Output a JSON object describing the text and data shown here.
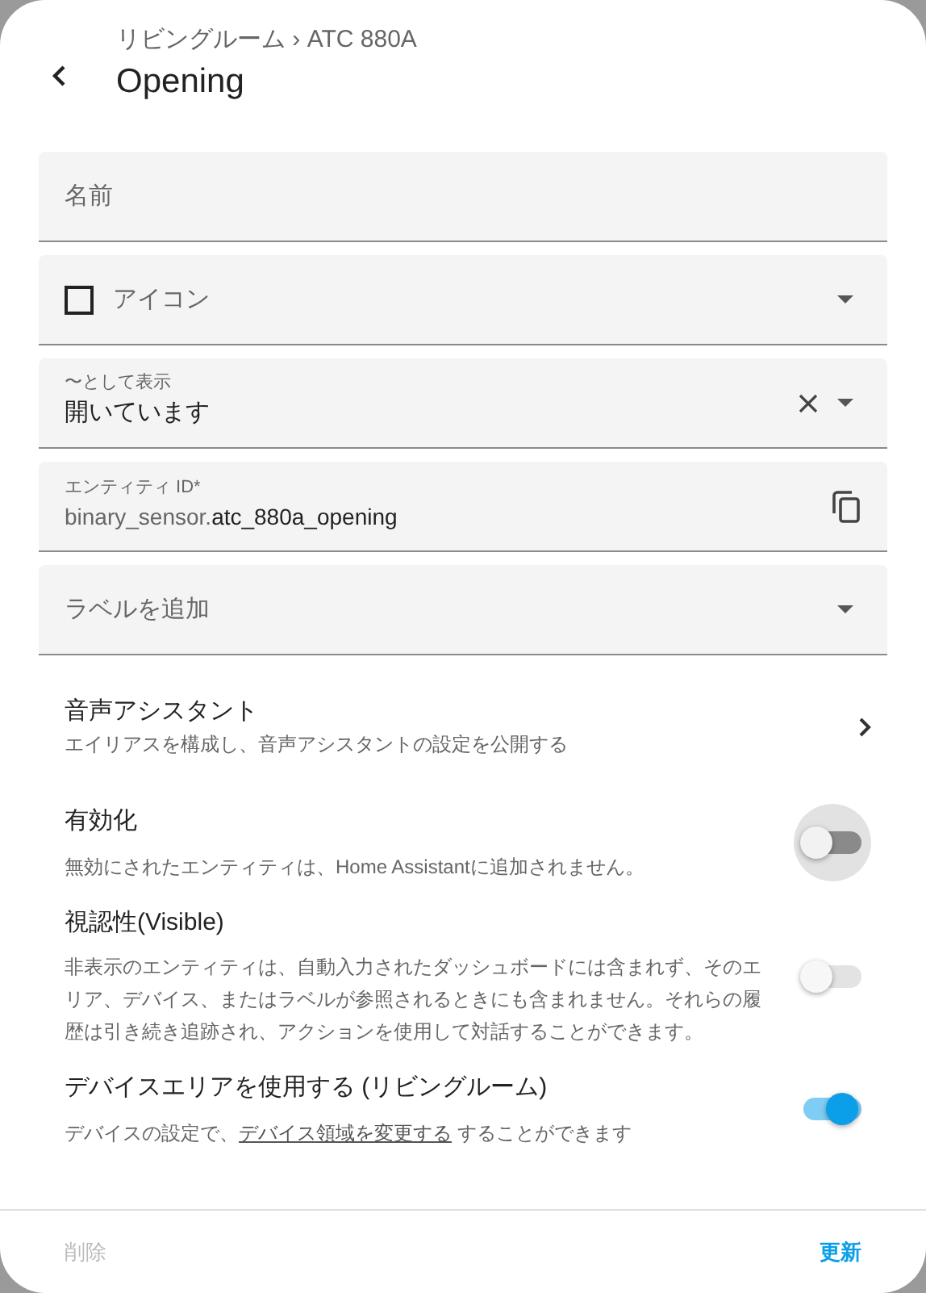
{
  "header": {
    "breadcrumb": "リビングルーム › ATC 880A",
    "title": "Opening"
  },
  "fields": [
    {
      "kind": "text",
      "placeholder": "名前"
    },
    {
      "kind": "icon",
      "placeholder": "アイコン"
    },
    {
      "kind": "select",
      "label": "〜として表示",
      "value": "開いています"
    },
    {
      "kind": "entity",
      "label": "エンティティ ID*",
      "prefix": "binary_sensor.",
      "value": "atc_880a_opening"
    },
    {
      "kind": "labels",
      "placeholder": "ラベルを追加"
    }
  ],
  "voice": {
    "title": "音声アシスタント",
    "description": "エイリアスを構成し、音声アシスタントの設定を公開する"
  },
  "settings": [
    {
      "title": "有効化",
      "description": "無効にされたエンティティは、Home Assistantに追加されません。",
      "on": false,
      "disabled": false,
      "focused": true
    },
    {
      "title": "視認性(Visible)",
      "description": "非表示のエンティティは、自動入力されたダッシュボードには含まれず、そのエリア、デバイス、またはラベルが参照されるときにも含まれません。それらの履歴は引き続き追跡され、アクションを使用して対話することができます。",
      "on": false,
      "disabled": true,
      "focused": false
    },
    {
      "title": "デバイスエリアを使用する (リビングルーム)",
      "description_before": "デバイスの設定で、",
      "link": "デバイス領域を変更する",
      "description_after": " することができます",
      "on": true,
      "disabled": false,
      "focused": false
    }
  ],
  "footer": {
    "delete": {
      "label": "削除",
      "disabled": true
    },
    "update": {
      "label": "更新",
      "disabled": false
    }
  }
}
